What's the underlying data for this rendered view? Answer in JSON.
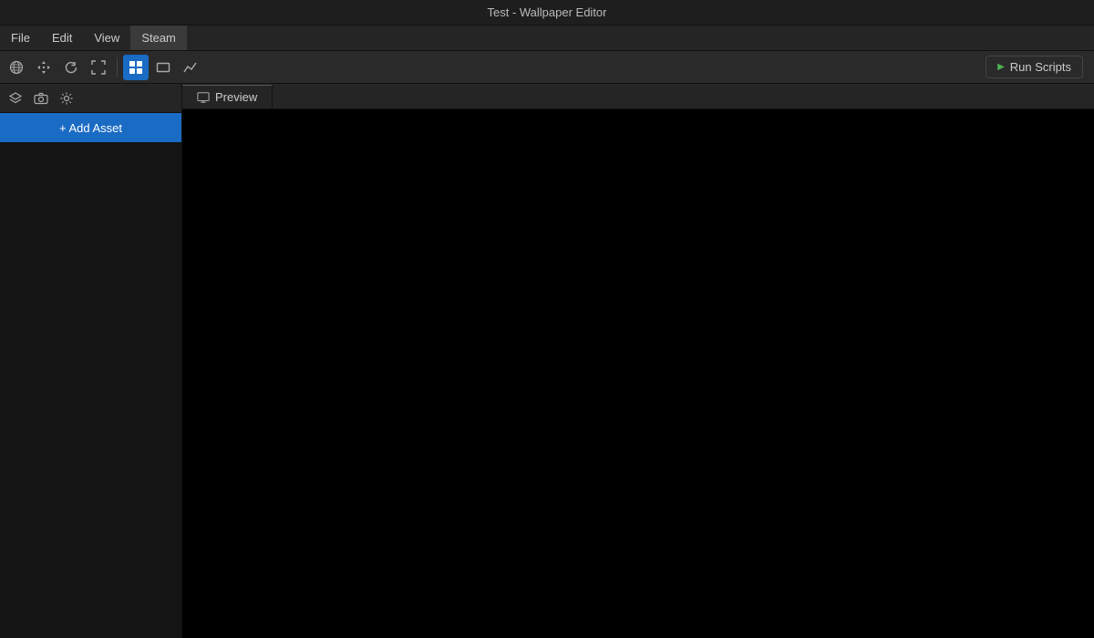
{
  "titleBar": {
    "text": "Test - Wallpaper Editor"
  },
  "menuBar": {
    "items": [
      {
        "id": "file",
        "label": "File"
      },
      {
        "id": "edit",
        "label": "Edit"
      },
      {
        "id": "view",
        "label": "View"
      },
      {
        "id": "steam",
        "label": "Steam",
        "active": true
      }
    ]
  },
  "toolbar": {
    "runScripts": {
      "label": "Run Scripts",
      "playIcon": "▶"
    },
    "buttons": [
      {
        "id": "globe",
        "title": "Globe/World"
      },
      {
        "id": "move",
        "title": "Move"
      },
      {
        "id": "refresh",
        "title": "Refresh"
      },
      {
        "id": "expand",
        "title": "Expand"
      },
      {
        "id": "grid",
        "title": "Grid view",
        "active": true
      },
      {
        "id": "rect",
        "title": "Rect view"
      },
      {
        "id": "chart",
        "title": "Chart view"
      }
    ]
  },
  "leftPanel": {
    "secondaryButtons": [
      {
        "id": "layers",
        "title": "Layers"
      },
      {
        "id": "camera",
        "title": "Camera"
      },
      {
        "id": "settings",
        "title": "Settings"
      }
    ],
    "addAsset": {
      "label": "+ Add Asset"
    }
  },
  "tabs": [
    {
      "id": "preview",
      "label": "Preview",
      "icon": "monitor",
      "active": true
    }
  ]
}
